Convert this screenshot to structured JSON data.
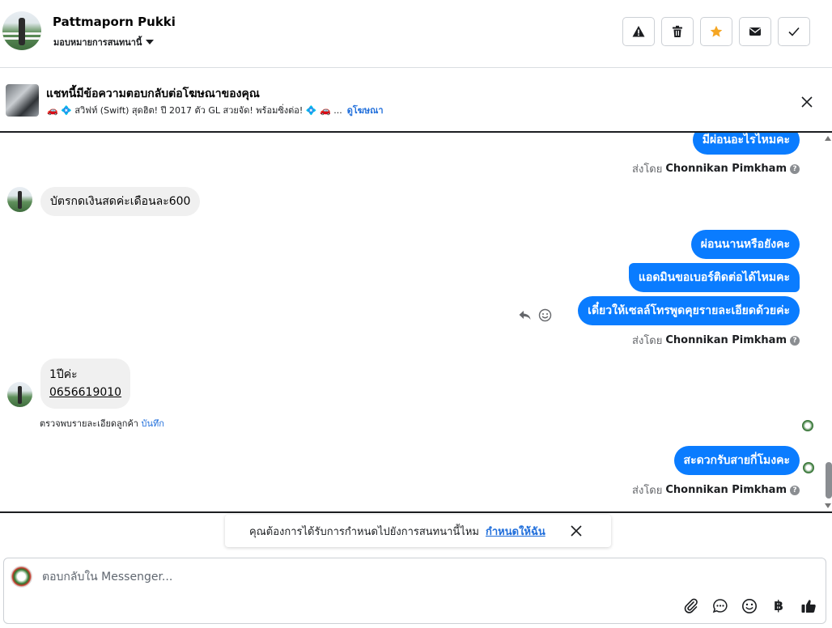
{
  "header": {
    "contact_name": "Pattmaporn Pukki",
    "assign_label": "มอบหมายการสนทนานี้",
    "actions": [
      {
        "name": "report-button",
        "icon": "warning-icon"
      },
      {
        "name": "delete-button",
        "icon": "trash-icon"
      },
      {
        "name": "star-button",
        "icon": "star-icon",
        "color": "#f5a623"
      },
      {
        "name": "mark-unread-button",
        "icon": "envelope-icon"
      },
      {
        "name": "mark-done-button",
        "icon": "check-icon"
      }
    ]
  },
  "ad_banner": {
    "title": "แชทนี้มีข้อความตอบกลับต่อโฆษณาของคุณ",
    "subtitle": "🚗 💠 สวิฟท์ (Swift) สุดฮิต! ปี 2017 ตัว GL สวยจัด! พร้อมซิ่งต่อ! 💠 🚗 ...",
    "link": "ดูโฆษณา"
  },
  "messages": [
    {
      "direction": "out",
      "text": "มีผ่อนอะไรไหมคะ"
    },
    {
      "sent_by_prefix": "ส่งโดย",
      "sent_by_name": "Chonnikan Pimkham"
    },
    {
      "direction": "in",
      "text": "บัตรกดเงินสดค่ะเดือนละ600"
    },
    {
      "direction": "out",
      "text": "ผ่อนนานหรือยังคะ"
    },
    {
      "direction": "out",
      "text": "แอดมินขอเบอร์ติดต่อได้ไหมคะ"
    },
    {
      "direction": "out",
      "text": "เดี๋ยวให้เซลล์โทรพูดคุยรายละเอียดด้วยค่ะ"
    },
    {
      "sent_by_prefix": "ส่งโดย",
      "sent_by_name": "Chonnikan Pimkham"
    },
    {
      "direction": "in",
      "line1": "1ปีค่ะ",
      "line2": "0656619010"
    },
    {
      "direction": "out",
      "text": "สะดวกรับสายกี่โมงคะ"
    },
    {
      "sent_by_prefix": "ส่งโดย",
      "sent_by_name": "Chonnikan Pimkham"
    }
  ],
  "customer_note": {
    "text": "ตรวจพบรายละเอียดลูกค้า",
    "link": "บันทึก"
  },
  "prompt": {
    "text": "คุณต้องการได้รับการกำหนดไปยังการสนทนานี้ไหม",
    "link": "กำหนดให้ฉัน"
  },
  "composer": {
    "placeholder": "ตอบกลับใน Messenger...",
    "tools": [
      "paperclip-icon",
      "saved-reply-icon",
      "emoji-icon",
      "baht-icon",
      "thumbs-up-icon"
    ],
    "baht_symbol": "฿"
  },
  "colors": {
    "outgoing_bubble": "#0a7cff",
    "incoming_bubble": "#f0f0f0",
    "link": "#216fdb",
    "star": "#f5a623"
  }
}
